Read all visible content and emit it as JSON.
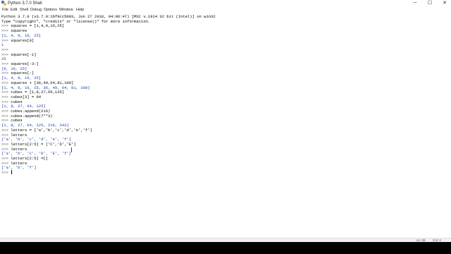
{
  "window": {
    "title": "Python 3.7.0 Shell",
    "minimize": "─",
    "maximize": "☐",
    "close": "✕"
  },
  "menu": [
    "File",
    "Edit",
    "Shell",
    "Debug",
    "Options",
    "Window",
    "Help"
  ],
  "shell": {
    "lines": [
      {
        "type": "info",
        "prompt": "",
        "text": "Python 3.7.0 (v3.7.0:1bf9cc5093, Jun 27 2018, 04:06:47) [MSC v.1914 32 bit (Intel)] on win32"
      },
      {
        "type": "info",
        "prompt": "",
        "text": "Type \"copyright\", \"credits\" or \"license()\" for more information."
      },
      {
        "type": "input",
        "prompt": ">>> ",
        "text": "squares = [1,4,9,16,25]"
      },
      {
        "type": "input",
        "prompt": ">>> ",
        "text": "squares"
      },
      {
        "type": "output",
        "prompt": "",
        "text": "[1, 4, 9, 16, 25]"
      },
      {
        "type": "input",
        "prompt": ">>> ",
        "text": "squares[0]"
      },
      {
        "type": "output",
        "prompt": "",
        "text": "1"
      },
      {
        "type": "input",
        "prompt": ">>> ",
        "text": ""
      },
      {
        "type": "input",
        "prompt": ">>> ",
        "text": "squares[-1]"
      },
      {
        "type": "output",
        "prompt": "",
        "text": "25"
      },
      {
        "type": "input",
        "prompt": ">>> ",
        "text": "squares[-3:]"
      },
      {
        "type": "output",
        "prompt": "",
        "text": "[9, 16, 25]"
      },
      {
        "type": "input",
        "prompt": ">>> ",
        "text": "squares[:]"
      },
      {
        "type": "output",
        "prompt": "",
        "text": "[1, 4, 9, 16, 25]"
      },
      {
        "type": "input",
        "prompt": ">>> ",
        "text": "squares + [36,49,64,81,100]"
      },
      {
        "type": "output",
        "prompt": "",
        "text": "[1, 4, 9, 16, 25, 36, 49, 64, 81, 100]"
      },
      {
        "type": "input",
        "prompt": ">>> ",
        "text": "cubes = [1,8,27,65,125]"
      },
      {
        "type": "input",
        "prompt": ">>> ",
        "text": "cubes[3] = 64"
      },
      {
        "type": "input",
        "prompt": ">>> ",
        "text": "cubes"
      },
      {
        "type": "output",
        "prompt": "",
        "text": "[1, 8, 27, 64, 125]"
      },
      {
        "type": "input",
        "prompt": ">>> ",
        "text": "cubes.append(216)"
      },
      {
        "type": "input",
        "prompt": ">>> ",
        "text": "cubes.append(7**3)"
      },
      {
        "type": "input",
        "prompt": ">>> ",
        "text": "cubes"
      },
      {
        "type": "output",
        "prompt": "",
        "text": "[1, 8, 27, 64, 125, 216, 343]"
      },
      {
        "type": "input",
        "prompt": ">>> ",
        "text": "letters = ['a','b','c','d','e','f']"
      },
      {
        "type": "input",
        "prompt": ">>> ",
        "text": "letters"
      },
      {
        "type": "output",
        "prompt": "",
        "text": "['a', 'b', 'c', 'd', 'e', 'f']"
      },
      {
        "type": "input",
        "prompt": ">>> ",
        "text": "letters[2:5] = ['C','D','E']"
      },
      {
        "type": "input",
        "prompt": ">>> ",
        "text": "letters"
      },
      {
        "type": "output",
        "prompt": "",
        "text": "['a', 'b', 'C', 'D', 'E', 'f']"
      },
      {
        "type": "input",
        "prompt": ">>> ",
        "text": "letters[2:5] =[]"
      },
      {
        "type": "input",
        "prompt": ">>> ",
        "text": "letters"
      },
      {
        "type": "output",
        "prompt": "",
        "text": "['a', 'b', 'f']"
      },
      {
        "type": "input",
        "prompt": ">>> ",
        "text": "",
        "cursor": true
      }
    ]
  },
  "status": {
    "line": "Ln: 33",
    "col": "Col: 4"
  },
  "colors": {
    "output_text": "#1a3fa8",
    "prompt_text": "#5c5c5c"
  }
}
